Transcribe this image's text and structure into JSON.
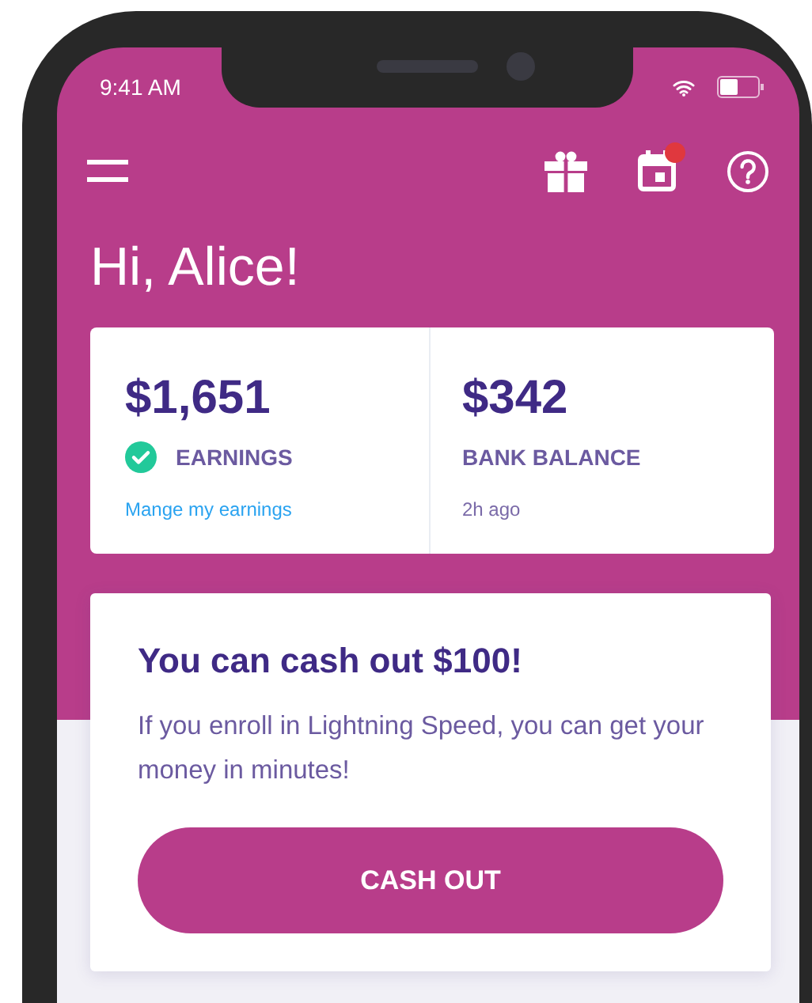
{
  "status_bar": {
    "time": "9:41 AM"
  },
  "nav": {
    "calendar_notification": true
  },
  "greeting": "Hi, Alice!",
  "balances": [
    {
      "amount": "$1,651",
      "label": "EARNINGS",
      "verified": true,
      "footer": {
        "kind": "link",
        "text": "Mange my earnings"
      }
    },
    {
      "amount": "$342",
      "label": "BANK BALANCE",
      "verified": false,
      "footer": {
        "kind": "note",
        "text": "2h ago"
      }
    }
  ],
  "offer": {
    "title": "You can cash out $100!",
    "body": "If you enroll in Lightning Speed, you can get your money in minutes!",
    "button": "CASH OUT"
  }
}
